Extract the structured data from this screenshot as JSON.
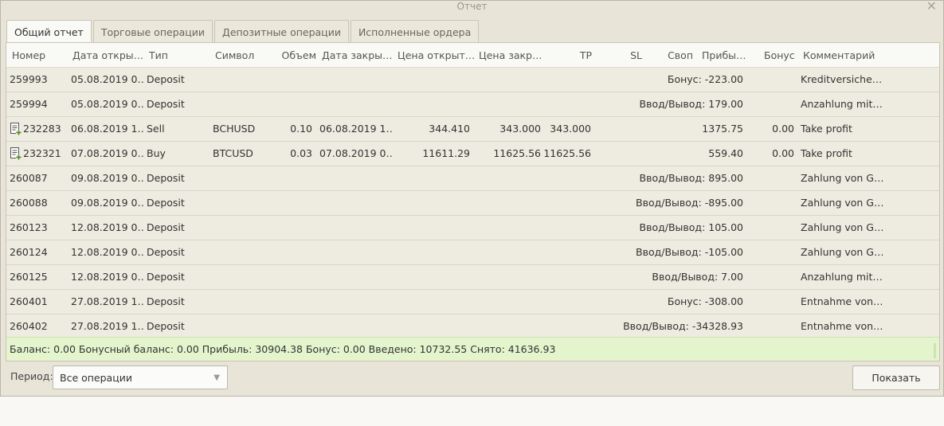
{
  "window": {
    "title": "Отчет"
  },
  "tabs": [
    {
      "label": "Общий отчет",
      "active": true
    },
    {
      "label": "Торговые операции",
      "active": false
    },
    {
      "label": "Депозитные операции",
      "active": false
    },
    {
      "label": "Исполненные ордера",
      "active": false
    }
  ],
  "table": {
    "columns": {
      "number": "Номер",
      "open_date": "Дата откры…",
      "type": "Тип",
      "symbol": "Символ",
      "volume": "Объем",
      "close_date": "Дата закры…",
      "open_price": "Цена открыт…",
      "close_price": "Цена закр…",
      "tp": "TP",
      "sl": "SL",
      "swap": "Своп",
      "profit": "Прибы…",
      "bonus": "Бонус",
      "comment": "Комментарий"
    },
    "rows": [
      {
        "number": "259993",
        "open_date": "05.08.2019 0…",
        "type": "Deposit",
        "symbol": "",
        "volume": "",
        "close_date": "",
        "open_price": "",
        "close_price": "",
        "tp": "",
        "sl": "",
        "swap": "",
        "profit": "Бонус: -223.00",
        "bonus": "",
        "comment": "Kreditversiche…",
        "order_icon": false
      },
      {
        "number": "259994",
        "open_date": "05.08.2019 0…",
        "type": "Deposit",
        "symbol": "",
        "volume": "",
        "close_date": "",
        "open_price": "",
        "close_price": "",
        "tp": "",
        "sl": "",
        "swap": "",
        "profit": "Ввод/Вывод: 179.00",
        "bonus": "",
        "comment": "Anzahlung mit…",
        "order_icon": false
      },
      {
        "number": "232283",
        "open_date": "06.08.2019 1…",
        "type": "Sell",
        "symbol": "BCHUSD",
        "volume": "0.10",
        "close_date": "06.08.2019 1…",
        "open_price": "344.410",
        "close_price": "343.000",
        "tp": "343.000",
        "sl": "",
        "swap": "",
        "profit": "1375.75",
        "bonus": "0.00",
        "comment": "Take profit",
        "order_icon": true
      },
      {
        "number": "232321",
        "open_date": "07.08.2019 0…",
        "type": "Buy",
        "symbol": "BTCUSD",
        "volume": "0.03",
        "close_date": "07.08.2019 0…",
        "open_price": "11611.29",
        "close_price": "11625.56",
        "tp": "11625.56",
        "sl": "",
        "swap": "",
        "profit": "559.40",
        "bonus": "0.00",
        "comment": "Take profit",
        "order_icon": true
      },
      {
        "number": "260087",
        "open_date": "09.08.2019 0…",
        "type": "Deposit",
        "symbol": "",
        "volume": "",
        "close_date": "",
        "open_price": "",
        "close_price": "",
        "tp": "",
        "sl": "",
        "swap": "",
        "profit": "Ввод/Вывод: 895.00",
        "bonus": "",
        "comment": "Zahlung von G…",
        "order_icon": false
      },
      {
        "number": "260088",
        "open_date": "09.08.2019 0…",
        "type": "Deposit",
        "symbol": "",
        "volume": "",
        "close_date": "",
        "open_price": "",
        "close_price": "",
        "tp": "",
        "sl": "",
        "swap": "",
        "profit": "Ввод/Вывод: -895.00",
        "bonus": "",
        "comment": "Zahlung von G…",
        "order_icon": false
      },
      {
        "number": "260123",
        "open_date": "12.08.2019 0…",
        "type": "Deposit",
        "symbol": "",
        "volume": "",
        "close_date": "",
        "open_price": "",
        "close_price": "",
        "tp": "",
        "sl": "",
        "swap": "",
        "profit": "Ввод/Вывод: 105.00",
        "bonus": "",
        "comment": "Zahlung von G…",
        "order_icon": false
      },
      {
        "number": "260124",
        "open_date": "12.08.2019 0…",
        "type": "Deposit",
        "symbol": "",
        "volume": "",
        "close_date": "",
        "open_price": "",
        "close_price": "",
        "tp": "",
        "sl": "",
        "swap": "",
        "profit": "Ввод/Вывод: -105.00",
        "bonus": "",
        "comment": "Zahlung von G…",
        "order_icon": false
      },
      {
        "number": "260125",
        "open_date": "12.08.2019 0…",
        "type": "Deposit",
        "symbol": "",
        "volume": "",
        "close_date": "",
        "open_price": "",
        "close_price": "",
        "tp": "",
        "sl": "",
        "swap": "",
        "profit": "Ввод/Вывод: 7.00",
        "bonus": "",
        "comment": "Anzahlung mit…",
        "order_icon": false
      },
      {
        "number": "260401",
        "open_date": "27.08.2019 1…",
        "type": "Deposit",
        "symbol": "",
        "volume": "",
        "close_date": "",
        "open_price": "",
        "close_price": "",
        "tp": "",
        "sl": "",
        "swap": "",
        "profit": "Бонус: -308.00",
        "bonus": "",
        "comment": "Entnahme von…",
        "order_icon": false
      },
      {
        "number": "260402",
        "open_date": "27.08.2019 1…",
        "type": "Deposit",
        "symbol": "",
        "volume": "",
        "close_date": "",
        "open_price": "",
        "close_price": "",
        "tp": "",
        "sl": "",
        "swap": "",
        "profit": "Ввод/Вывод: -34328.93",
        "bonus": "",
        "comment": "Entnahme von…",
        "order_icon": false
      }
    ]
  },
  "summary": {
    "text": "Баланс: 0.00   Бонусный баланс: 0.00   Прибыль: 30904.38   Бонус: 0.00   Введено: 10732.55   Снято: 41636.93"
  },
  "footer": {
    "period_label": "Период:",
    "period_value": "Все операции",
    "show_button": "Показать"
  },
  "icons": {
    "order_icon": "order-document-icon",
    "close_icon": "close-icon",
    "dropdown_icon": "chevron-down-icon"
  },
  "colors": {
    "summary_bg": "#e4f5cd",
    "order_icon": "#4a8a2a"
  }
}
